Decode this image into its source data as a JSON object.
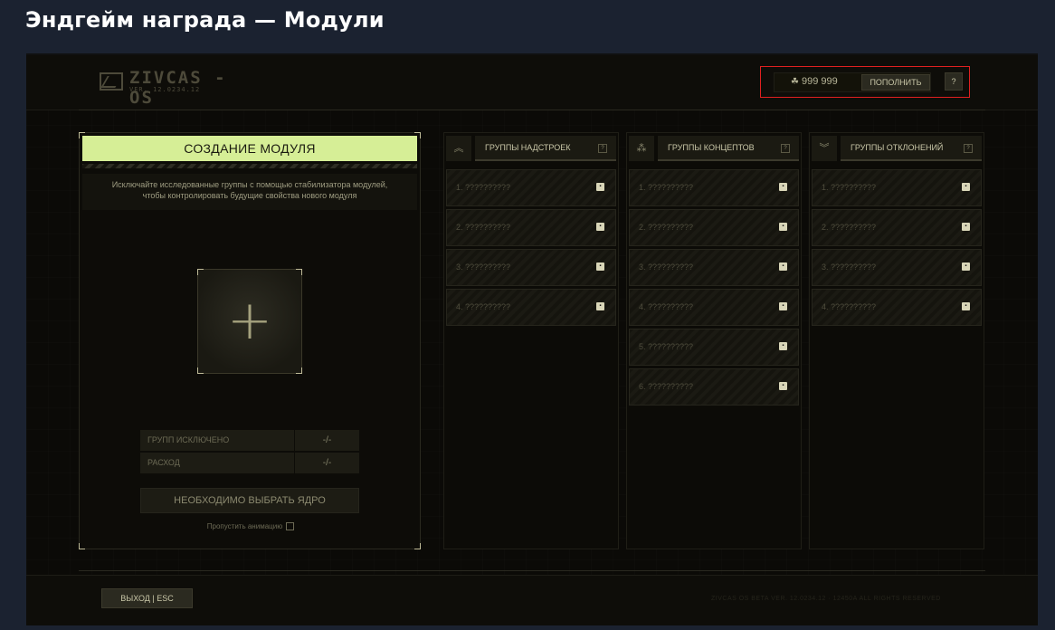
{
  "page": {
    "title": "Эндгейм награда — Модули"
  },
  "topbar": {
    "logo_text": "ZIVCAS - OS",
    "version": "VER. 12.0234.12",
    "currency": {
      "icon": "☘",
      "amount": "999 999"
    },
    "topup_label": "ПОПОЛНИТЬ",
    "help_label": "?"
  },
  "create": {
    "header": "СОЗДАНИЕ МОДУЛЯ",
    "description_line1": "Исключайте исследованные группы с помощью стабилизатора модулей,",
    "description_line2": "чтобы контролировать будущие свойства нового модуля",
    "add_symbol": "+",
    "stats": [
      {
        "label": "ГРУПП ИСКЛЮЧЕНО",
        "value": "-/-"
      },
      {
        "label": "РАСХОД",
        "value": "-/-"
      }
    ],
    "select_core_label": "НЕОБХОДИМО ВЫБРАТЬ ЯДРО",
    "skip_animation_label": "Пропустить анимацию"
  },
  "groups": [
    {
      "title": "ГРУППЫ НАДСТРОЕК",
      "icon": "︽",
      "help": "?",
      "items": [
        "1. ??????????",
        "2. ??????????",
        "3. ??????????",
        "4. ??????????"
      ]
    },
    {
      "title": "ГРУППЫ КОНЦЕПТОВ",
      "icon": "⁂",
      "help": "?",
      "items": [
        "1. ??????????",
        "2. ??????????",
        "3. ??????????",
        "4. ??????????",
        "5. ??????????",
        "6. ??????????"
      ]
    },
    {
      "title": "ГРУППЫ ОТКЛОНЕНИЙ",
      "icon": "︾",
      "help": "?",
      "items": [
        "1. ??????????",
        "2. ??????????",
        "3. ??????????",
        "4. ??????????"
      ]
    }
  ],
  "lock_glyph": "▪",
  "bottombar": {
    "exit_label": "ВЫХОД | ESC",
    "copyright": "ZIVCAS OS BETA VER. 12.0234.12 · 12450A ALL RIGHTS RESERVED"
  },
  "colors": {
    "accent": "#d6ee96",
    "highlight_border": "#e02020",
    "background": "#0b0a07"
  }
}
